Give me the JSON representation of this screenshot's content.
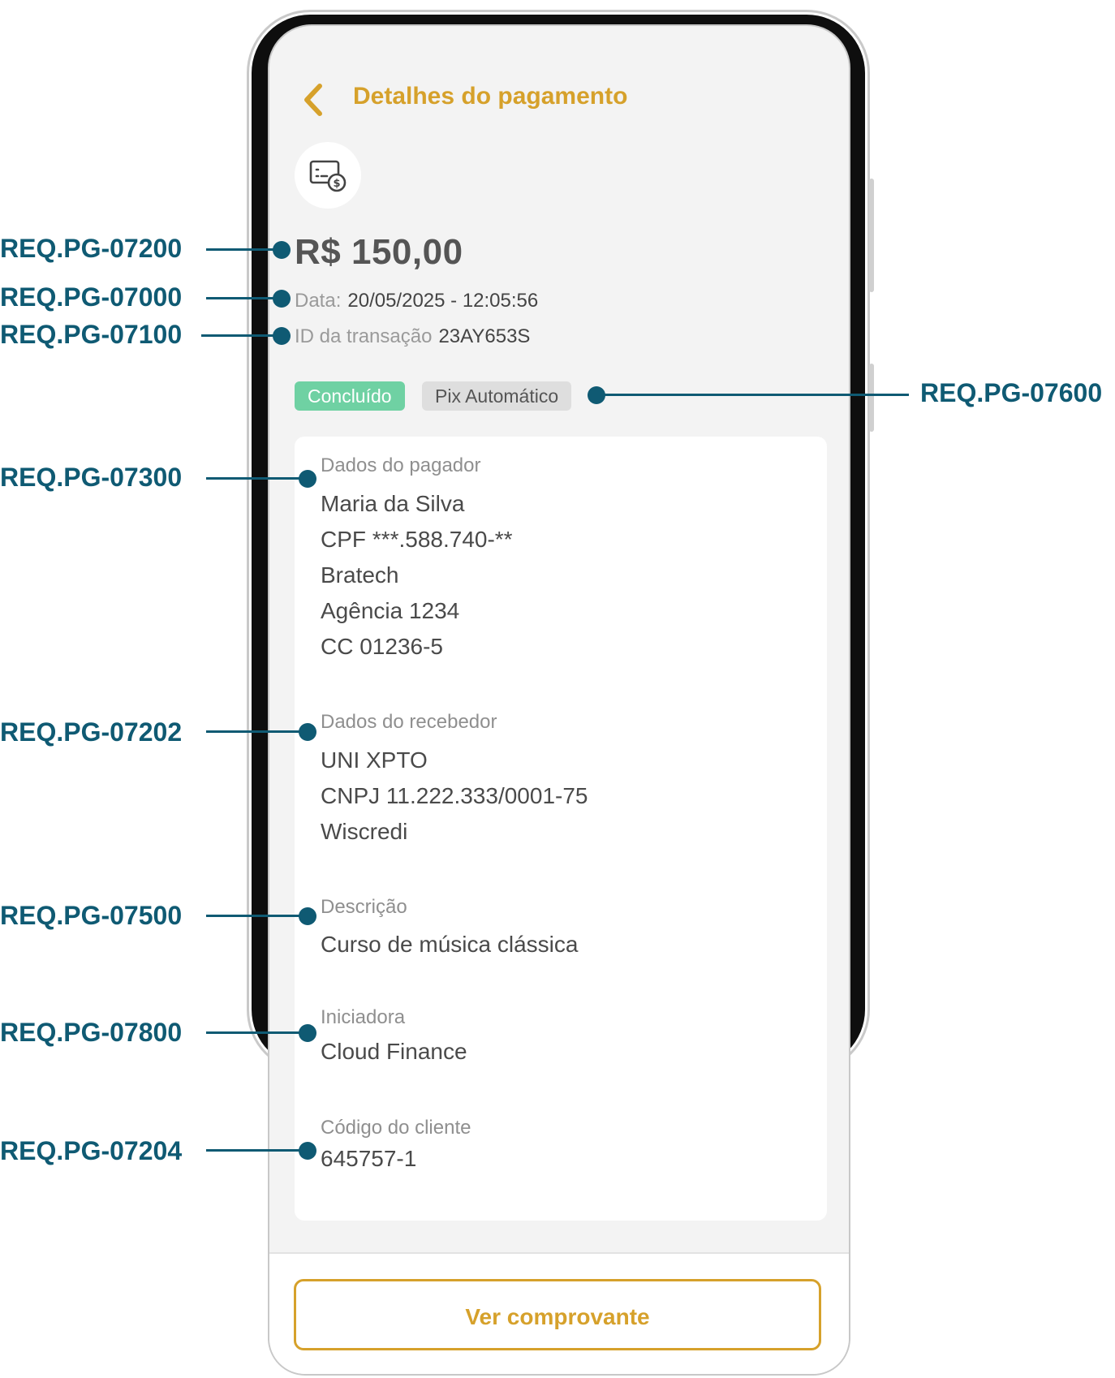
{
  "header": {
    "title": "Detalhes do pagamento"
  },
  "payment": {
    "amount": "R$ 150,00",
    "date_label": "Data:",
    "date_value": "20/05/2025 - 12:05:56",
    "tx_label": "ID da transação",
    "tx_value": "23AY653S",
    "status_badge": "Concluído",
    "type_badge": "Pix Automático"
  },
  "payer": {
    "label": "Dados do pagador",
    "lines": [
      "Maria da Silva",
      "CPF ***.588.740-**",
      "Bratech",
      "Agência 1234",
      "CC 01236-5"
    ]
  },
  "receiver": {
    "label": "Dados do recebedor",
    "lines": [
      "UNI XPTO",
      "CNPJ 11.222.333/0001-75",
      "Wiscredi"
    ]
  },
  "description": {
    "label": "Descrição",
    "value": "Curso de música clássica"
  },
  "initiator": {
    "label": "Iniciadora",
    "value": "Cloud Finance"
  },
  "client_code": {
    "label": "Código do cliente",
    "value": "645757-1"
  },
  "footer": {
    "button_label": "Ver comprovante"
  },
  "annotations": [
    "REQ.PG-07200",
    "REQ.PG-07000",
    "REQ.PG-07100",
    "REQ.PG-07600",
    "REQ.PG-07300",
    "REQ.PG-07202",
    "REQ.PG-07500",
    "REQ.PG-07800",
    "REQ.PG-07204"
  ],
  "colors": {
    "accent": "#d6a12b",
    "annotation": "#0f5a73",
    "status_success": "#6fd1a3"
  },
  "icons": {
    "back": "chevron-left-icon",
    "payment": "card-dollar-icon"
  }
}
